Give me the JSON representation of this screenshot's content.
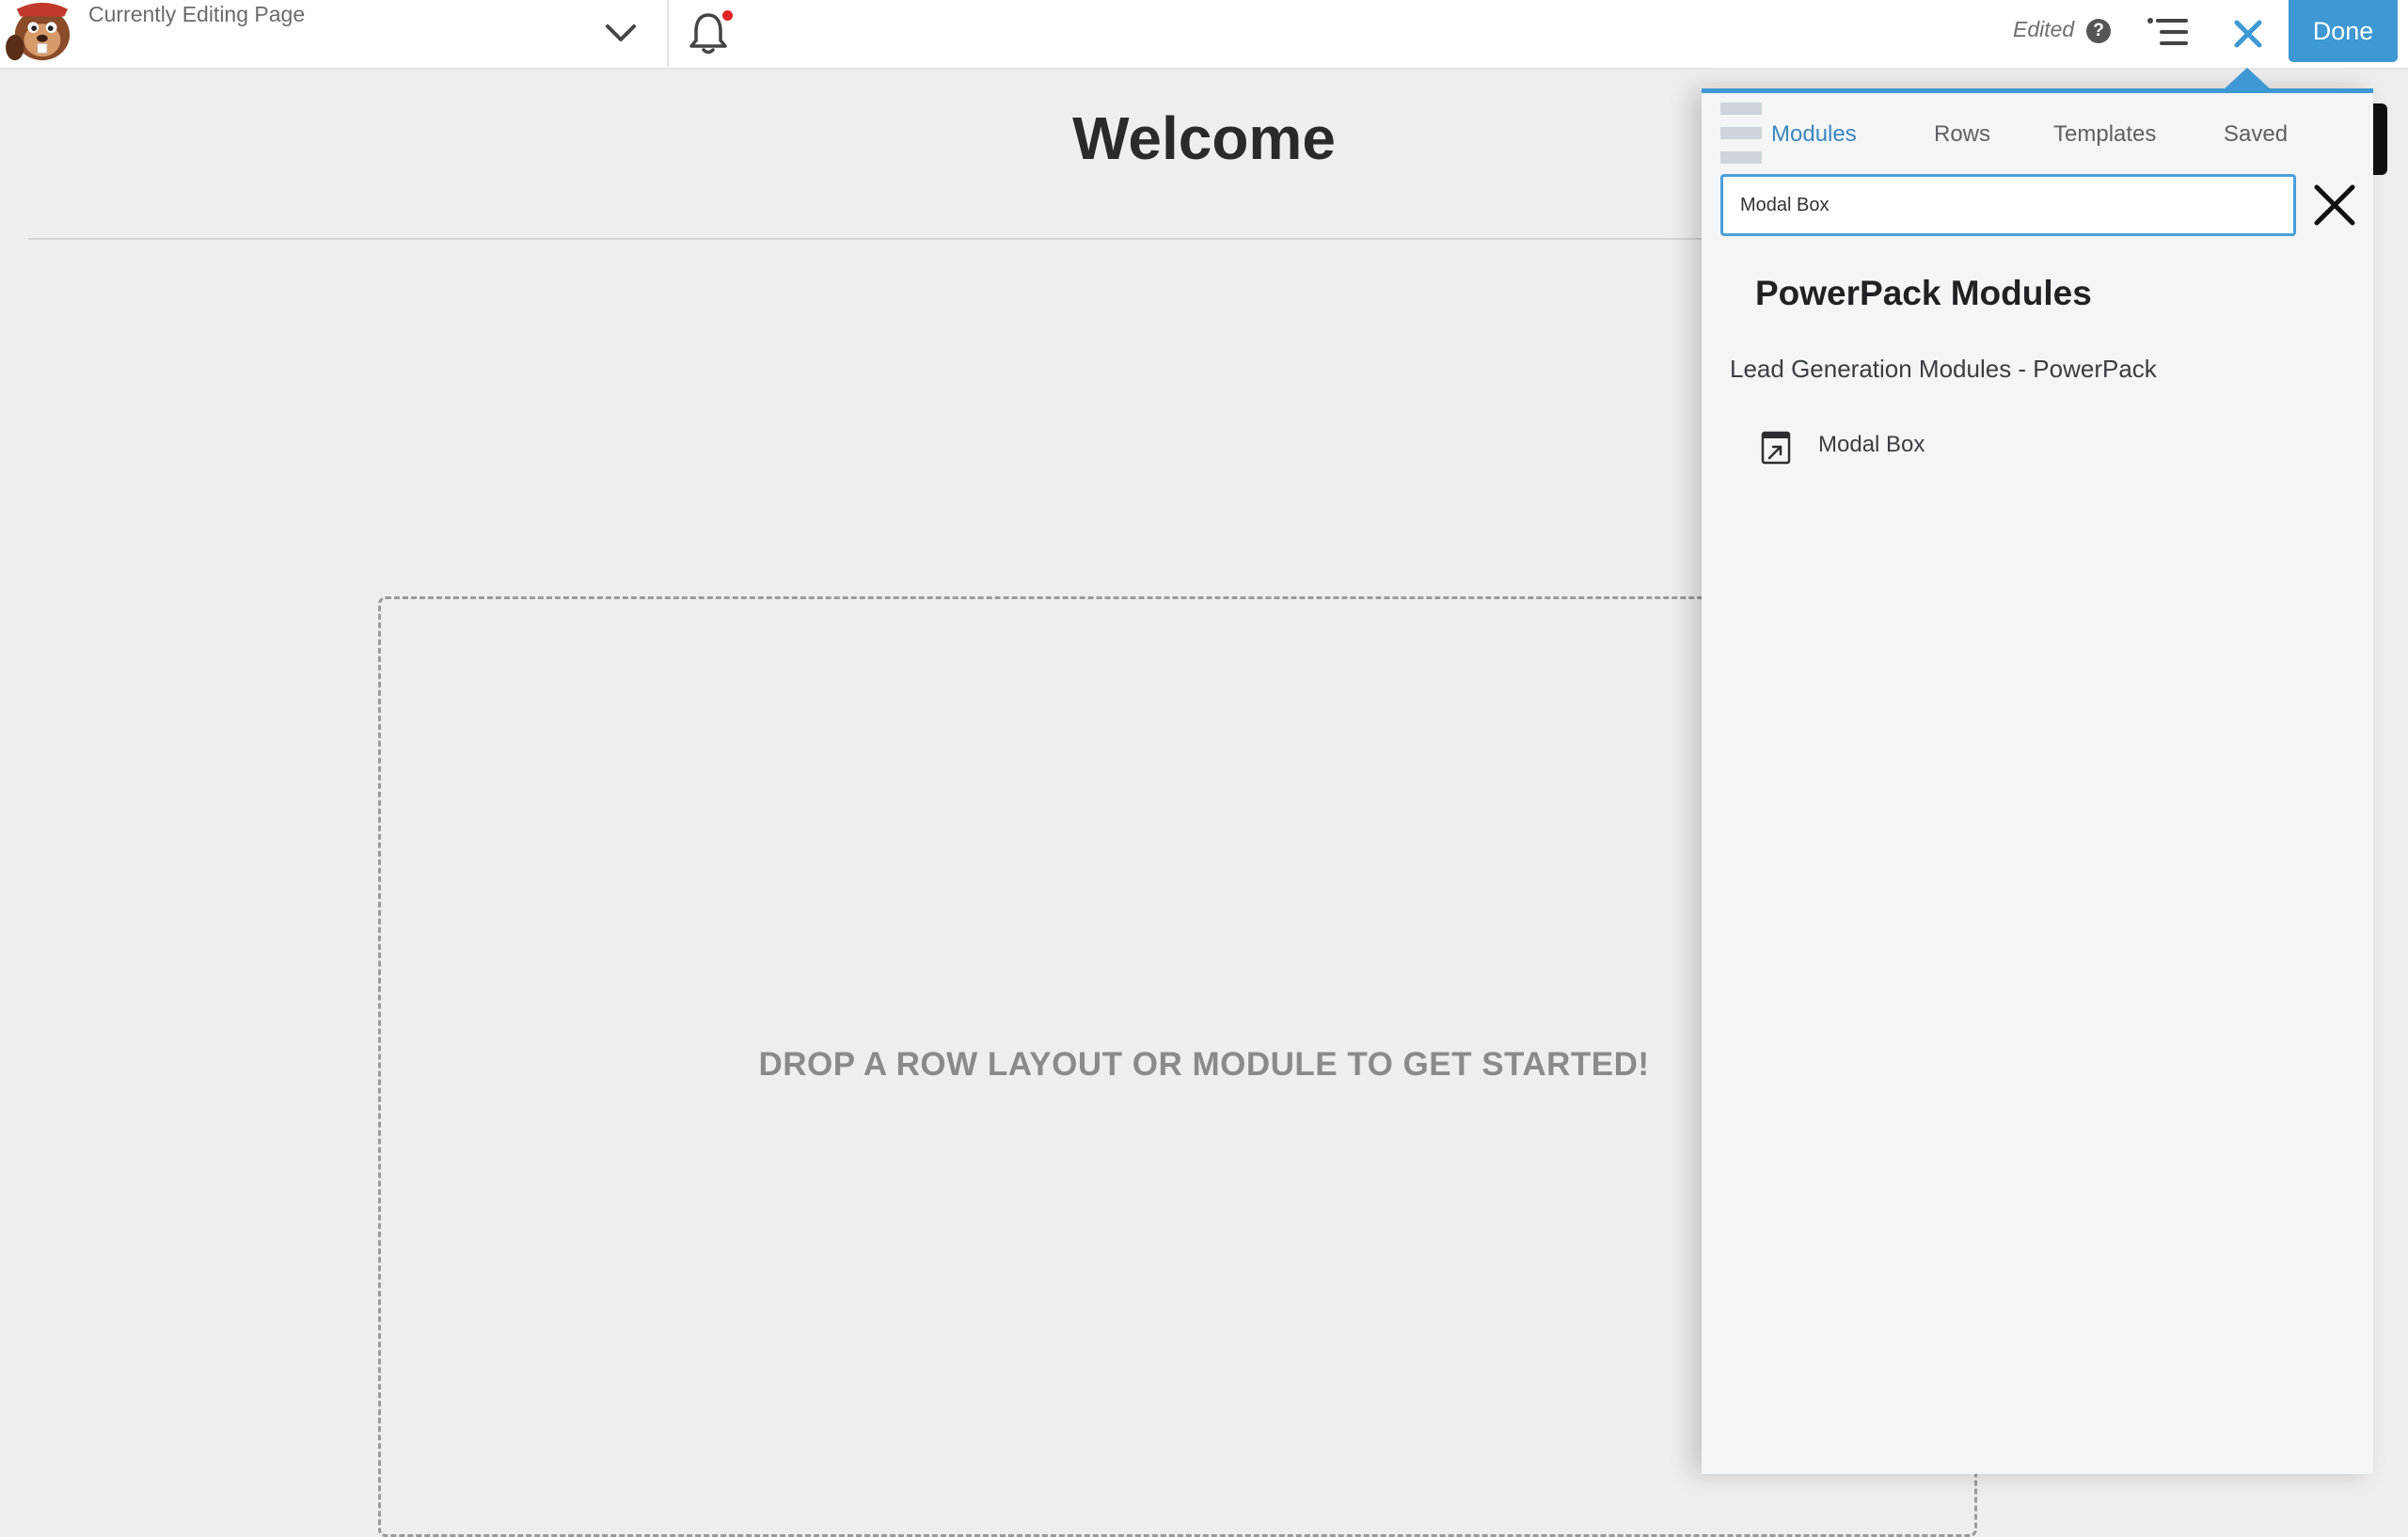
{
  "topbar": {
    "editing_label": "Currently Editing Page",
    "status_label": "Edited",
    "help_glyph": "?",
    "done_label": "Done"
  },
  "canvas": {
    "title": "Welcome",
    "drop_message": "DROP A ROW LAYOUT OR MODULE TO GET STARTED!"
  },
  "panel": {
    "tabs": [
      {
        "label": "Modules",
        "active": true
      },
      {
        "label": "Rows",
        "active": false
      },
      {
        "label": "Templates",
        "active": false
      },
      {
        "label": "Saved",
        "active": false
      }
    ],
    "search": {
      "value": "Modal Box",
      "placeholder": ""
    },
    "group_title": "PowerPack Modules",
    "category_title": "Lead Generation Modules - PowerPack",
    "modules": [
      {
        "label": "Modal Box",
        "icon": "modal-box-icon"
      }
    ]
  },
  "colors": {
    "accent": "#3d98d3",
    "active_tab": "#3a86bf",
    "notification": "#e02424"
  }
}
